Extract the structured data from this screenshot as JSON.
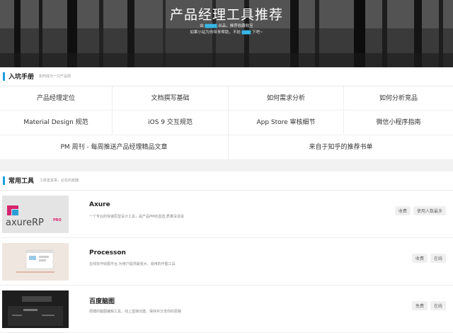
{
  "hero": {
    "title": "产品经理工具推荐",
    "sub1_a": "由",
    "sub1_b": "出品，推荐收藏收至",
    "sub2_a": "如果小站为你带来帮助，不妨",
    "sub2_b": "下吧~"
  },
  "guide": {
    "title": "入坑手册",
    "desc": "如何成为一只产品狗",
    "rows": [
      [
        "产品经理定位",
        "文档撰写基础",
        "如何需求分析",
        "如何分析竞品"
      ],
      [
        "Material Design 规范",
        "iOS 9 交互规范",
        "App Store 审核细节",
        "微信小程序指南"
      ],
      [
        "PM 周刊 - 每周推送产品经理精品文章",
        "来自于知乎的推荐书单"
      ]
    ]
  },
  "tools": {
    "title": "常用工具",
    "desc": "工欲善其事，必先利其器",
    "items": [
      {
        "name": "Axure",
        "desc": "一个专业的快速原型设计工具，是产品PM的首选,质量没话说",
        "tags": [
          "收费",
          "使用人数最多"
        ]
      },
      {
        "name": "Processon",
        "desc": "在线协作绘图平台,为用户提供最强大、易用的作图工具",
        "tags": [
          "收费",
          "在线"
        ]
      },
      {
        "name": "百度脑图",
        "desc": "便捷的脑图编辑工具，线上直接创建、保存并分享你的思路",
        "tags": [
          "免费",
          "在线"
        ]
      }
    ]
  },
  "colors": {
    "accent": "#1a9fe0",
    "link": "#39b7e8"
  },
  "icons": [
    "axure-logo",
    "processon-screenshot",
    "baidu-naotu-screenshot"
  ]
}
